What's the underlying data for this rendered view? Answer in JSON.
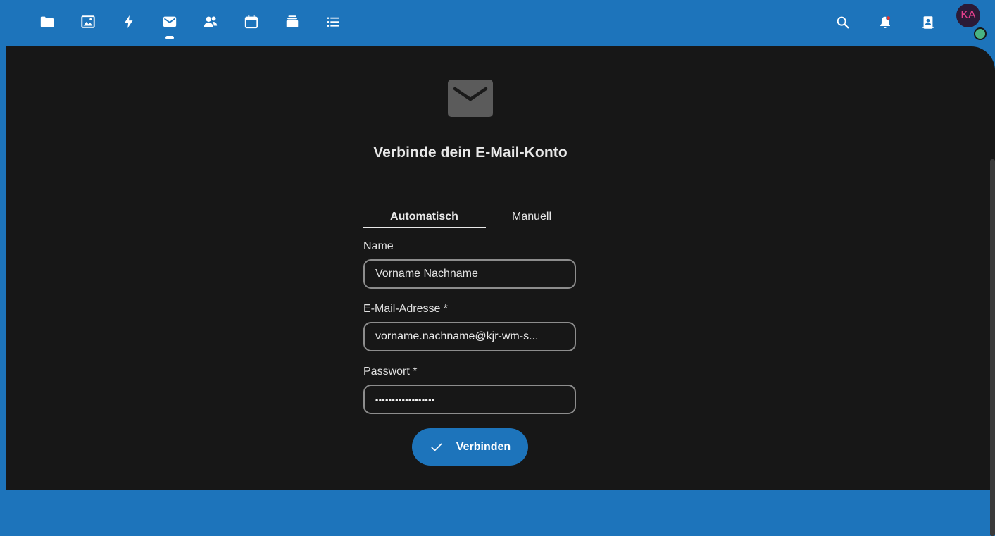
{
  "header": {
    "apps": [
      {
        "icon": "folder-icon",
        "name": "files"
      },
      {
        "icon": "image-icon",
        "name": "photos"
      },
      {
        "icon": "lightning-icon",
        "name": "activity"
      },
      {
        "icon": "mail-icon",
        "name": "mail",
        "active": true
      },
      {
        "icon": "contacts-icon",
        "name": "contacts"
      },
      {
        "icon": "calendar-icon",
        "name": "calendar"
      },
      {
        "icon": "deck-icon",
        "name": "deck"
      },
      {
        "icon": "list-icon",
        "name": "tasks"
      }
    ],
    "right_icons": [
      "search-icon",
      "notifications-icon",
      "contacts-menu-icon"
    ],
    "avatar_initials": "KA"
  },
  "main": {
    "title": "Verbinde dein E-Mail-Konto",
    "tabs": [
      {
        "label": "Automatisch",
        "active": true
      },
      {
        "label": "Manuell",
        "active": false
      }
    ],
    "form": {
      "name_label": "Name",
      "name_value": "Vorname Nachname",
      "email_label": "E-Mail-Adresse *",
      "email_value": "vorname.nachname@kjr-wm-s...",
      "password_label": "Passwort *",
      "password_mask": "••••••••••••••••••",
      "submit_label": "Verbinden"
    }
  },
  "colors": {
    "header_bg": "#1d74bb",
    "content_bg": "#171717",
    "primary": "#1d74bb",
    "status_online": "#49b382",
    "notification_dot": "#e9322d"
  }
}
